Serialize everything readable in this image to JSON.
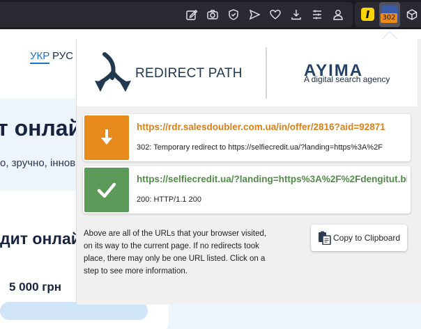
{
  "toolbar": {
    "icons": [
      "edit-icon",
      "screenshot-icon",
      "shield-icon",
      "send-icon",
      "heart-icon",
      "download-icon",
      "menu-lines-icon",
      "account-icon",
      "extension-yellow-icon",
      "redirect-path-extension-icon",
      "extensions-puzzle-icon"
    ],
    "badge_count": "302"
  },
  "page": {
    "lang_ukr": "УКР",
    "lang_rus": "РУС",
    "heading1": "т онлай",
    "subline": "о, зручно, іннов",
    "heading2": "дит онлай",
    "amount": "5 000  грн"
  },
  "popup": {
    "title": "REDIRECT PATH",
    "ayima": "AYIMA",
    "ayima_tagline": "A digital search agency",
    "steps": [
      {
        "url": "https://rdr.salesdoubler.com.ua/in/offer/2816?aid=92871",
        "status": "302: Temporary redirect to https://selfiecredit.ua/?landing=https%3A%2F",
        "icon": "down-arrow-icon",
        "color": "#e8891c"
      },
      {
        "url": "https://selfiecredit.ua/?landing=https%3A%2F%2Fdengitut.bi",
        "status": "200: HTTP/1.1 200",
        "icon": "checkmark-icon",
        "color": "#5b9a58"
      }
    ],
    "info_text": "Above are all of the URLs that your browser visited, on its way to the current page. If no redirects took place, there may only be one URL listed. Click on a step to see more information.",
    "copy_label": "Copy to Clipboard"
  },
  "colors": {
    "orange": "#e8891c",
    "green": "#5b9a58",
    "url_orange": "#d9801a",
    "url_green": "#4f8c46",
    "navy": "#22384f"
  }
}
